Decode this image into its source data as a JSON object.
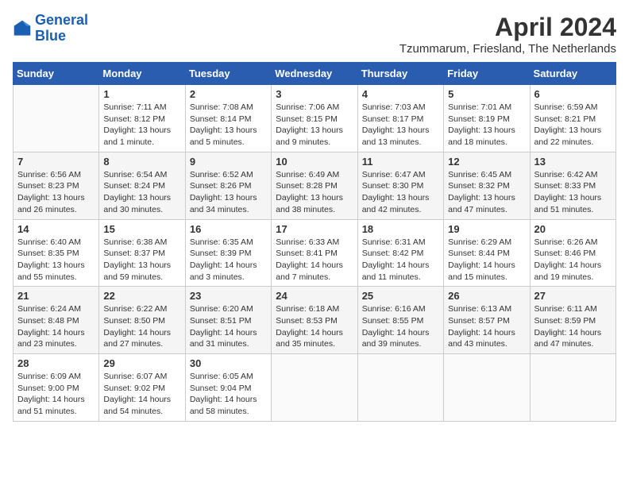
{
  "header": {
    "logo_line1": "General",
    "logo_line2": "Blue",
    "month_year": "April 2024",
    "location": "Tzummarum, Friesland, The Netherlands"
  },
  "weekdays": [
    "Sunday",
    "Monday",
    "Tuesday",
    "Wednesday",
    "Thursday",
    "Friday",
    "Saturday"
  ],
  "weeks": [
    [
      {
        "day": "",
        "sunrise": "",
        "sunset": "",
        "daylight": ""
      },
      {
        "day": "1",
        "sunrise": "Sunrise: 7:11 AM",
        "sunset": "Sunset: 8:12 PM",
        "daylight": "Daylight: 13 hours and 1 minute."
      },
      {
        "day": "2",
        "sunrise": "Sunrise: 7:08 AM",
        "sunset": "Sunset: 8:14 PM",
        "daylight": "Daylight: 13 hours and 5 minutes."
      },
      {
        "day": "3",
        "sunrise": "Sunrise: 7:06 AM",
        "sunset": "Sunset: 8:15 PM",
        "daylight": "Daylight: 13 hours and 9 minutes."
      },
      {
        "day": "4",
        "sunrise": "Sunrise: 7:03 AM",
        "sunset": "Sunset: 8:17 PM",
        "daylight": "Daylight: 13 hours and 13 minutes."
      },
      {
        "day": "5",
        "sunrise": "Sunrise: 7:01 AM",
        "sunset": "Sunset: 8:19 PM",
        "daylight": "Daylight: 13 hours and 18 minutes."
      },
      {
        "day": "6",
        "sunrise": "Sunrise: 6:59 AM",
        "sunset": "Sunset: 8:21 PM",
        "daylight": "Daylight: 13 hours and 22 minutes."
      }
    ],
    [
      {
        "day": "7",
        "sunrise": "Sunrise: 6:56 AM",
        "sunset": "Sunset: 8:23 PM",
        "daylight": "Daylight: 13 hours and 26 minutes."
      },
      {
        "day": "8",
        "sunrise": "Sunrise: 6:54 AM",
        "sunset": "Sunset: 8:24 PM",
        "daylight": "Daylight: 13 hours and 30 minutes."
      },
      {
        "day": "9",
        "sunrise": "Sunrise: 6:52 AM",
        "sunset": "Sunset: 8:26 PM",
        "daylight": "Daylight: 13 hours and 34 minutes."
      },
      {
        "day": "10",
        "sunrise": "Sunrise: 6:49 AM",
        "sunset": "Sunset: 8:28 PM",
        "daylight": "Daylight: 13 hours and 38 minutes."
      },
      {
        "day": "11",
        "sunrise": "Sunrise: 6:47 AM",
        "sunset": "Sunset: 8:30 PM",
        "daylight": "Daylight: 13 hours and 42 minutes."
      },
      {
        "day": "12",
        "sunrise": "Sunrise: 6:45 AM",
        "sunset": "Sunset: 8:32 PM",
        "daylight": "Daylight: 13 hours and 47 minutes."
      },
      {
        "day": "13",
        "sunrise": "Sunrise: 6:42 AM",
        "sunset": "Sunset: 8:33 PM",
        "daylight": "Daylight: 13 hours and 51 minutes."
      }
    ],
    [
      {
        "day": "14",
        "sunrise": "Sunrise: 6:40 AM",
        "sunset": "Sunset: 8:35 PM",
        "daylight": "Daylight: 13 hours and 55 minutes."
      },
      {
        "day": "15",
        "sunrise": "Sunrise: 6:38 AM",
        "sunset": "Sunset: 8:37 PM",
        "daylight": "Daylight: 13 hours and 59 minutes."
      },
      {
        "day": "16",
        "sunrise": "Sunrise: 6:35 AM",
        "sunset": "Sunset: 8:39 PM",
        "daylight": "Daylight: 14 hours and 3 minutes."
      },
      {
        "day": "17",
        "sunrise": "Sunrise: 6:33 AM",
        "sunset": "Sunset: 8:41 PM",
        "daylight": "Daylight: 14 hours and 7 minutes."
      },
      {
        "day": "18",
        "sunrise": "Sunrise: 6:31 AM",
        "sunset": "Sunset: 8:42 PM",
        "daylight": "Daylight: 14 hours and 11 minutes."
      },
      {
        "day": "19",
        "sunrise": "Sunrise: 6:29 AM",
        "sunset": "Sunset: 8:44 PM",
        "daylight": "Daylight: 14 hours and 15 minutes."
      },
      {
        "day": "20",
        "sunrise": "Sunrise: 6:26 AM",
        "sunset": "Sunset: 8:46 PM",
        "daylight": "Daylight: 14 hours and 19 minutes."
      }
    ],
    [
      {
        "day": "21",
        "sunrise": "Sunrise: 6:24 AM",
        "sunset": "Sunset: 8:48 PM",
        "daylight": "Daylight: 14 hours and 23 minutes."
      },
      {
        "day": "22",
        "sunrise": "Sunrise: 6:22 AM",
        "sunset": "Sunset: 8:50 PM",
        "daylight": "Daylight: 14 hours and 27 minutes."
      },
      {
        "day": "23",
        "sunrise": "Sunrise: 6:20 AM",
        "sunset": "Sunset: 8:51 PM",
        "daylight": "Daylight: 14 hours and 31 minutes."
      },
      {
        "day": "24",
        "sunrise": "Sunrise: 6:18 AM",
        "sunset": "Sunset: 8:53 PM",
        "daylight": "Daylight: 14 hours and 35 minutes."
      },
      {
        "day": "25",
        "sunrise": "Sunrise: 6:16 AM",
        "sunset": "Sunset: 8:55 PM",
        "daylight": "Daylight: 14 hours and 39 minutes."
      },
      {
        "day": "26",
        "sunrise": "Sunrise: 6:13 AM",
        "sunset": "Sunset: 8:57 PM",
        "daylight": "Daylight: 14 hours and 43 minutes."
      },
      {
        "day": "27",
        "sunrise": "Sunrise: 6:11 AM",
        "sunset": "Sunset: 8:59 PM",
        "daylight": "Daylight: 14 hours and 47 minutes."
      }
    ],
    [
      {
        "day": "28",
        "sunrise": "Sunrise: 6:09 AM",
        "sunset": "Sunset: 9:00 PM",
        "daylight": "Daylight: 14 hours and 51 minutes."
      },
      {
        "day": "29",
        "sunrise": "Sunrise: 6:07 AM",
        "sunset": "Sunset: 9:02 PM",
        "daylight": "Daylight: 14 hours and 54 minutes."
      },
      {
        "day": "30",
        "sunrise": "Sunrise: 6:05 AM",
        "sunset": "Sunset: 9:04 PM",
        "daylight": "Daylight: 14 hours and 58 minutes."
      },
      {
        "day": "",
        "sunrise": "",
        "sunset": "",
        "daylight": ""
      },
      {
        "day": "",
        "sunrise": "",
        "sunset": "",
        "daylight": ""
      },
      {
        "day": "",
        "sunrise": "",
        "sunset": "",
        "daylight": ""
      },
      {
        "day": "",
        "sunrise": "",
        "sunset": "",
        "daylight": ""
      }
    ]
  ]
}
